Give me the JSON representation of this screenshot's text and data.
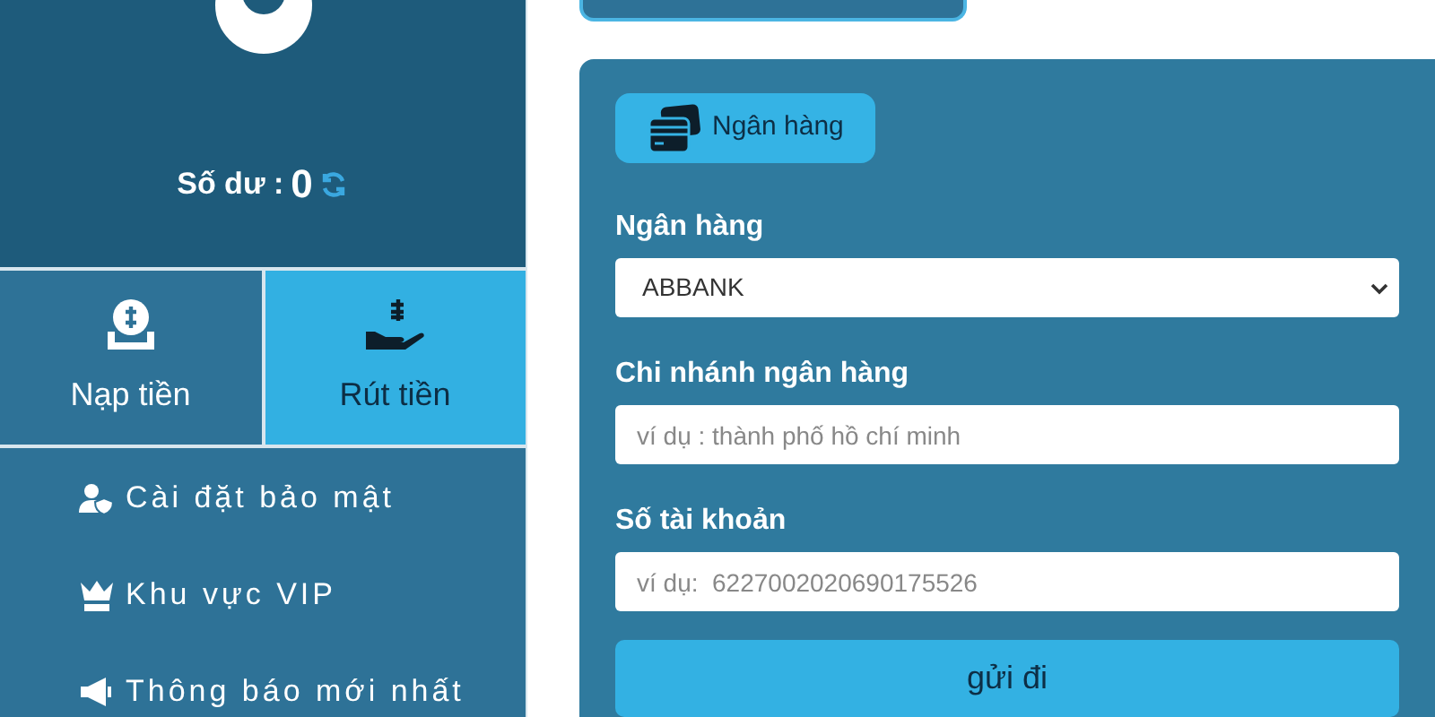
{
  "account": {
    "balance_label": "Số dư :",
    "balance": "0"
  },
  "actions": [
    {
      "label": "Nạp tiền",
      "kind": "deposit",
      "selected": false
    },
    {
      "label": "Rút tiền",
      "kind": "withdraw",
      "selected": true
    }
  ],
  "menu": [
    {
      "label": "Cài đặt bảo mật",
      "kind": "security"
    },
    {
      "label": "Khu vực VIP",
      "kind": "vip"
    },
    {
      "label": "Thông báo mới nhất",
      "kind": "notice"
    }
  ],
  "form": {
    "tabs": [
      {
        "label": "Ngân hàng",
        "selected": true
      }
    ],
    "fields": [
      {
        "kind": "select",
        "label": "Ngân hàng",
        "value": "ABBANK"
      },
      {
        "kind": "text",
        "label": "Chi nhánh ngân hàng",
        "placeholder": "ví dụ : thành phố hồ chí minh"
      },
      {
        "kind": "text",
        "label": "Số tài khoản",
        "placeholder": "ví dụ:  6227002020690175526"
      }
    ],
    "submit": "gửi đi"
  }
}
